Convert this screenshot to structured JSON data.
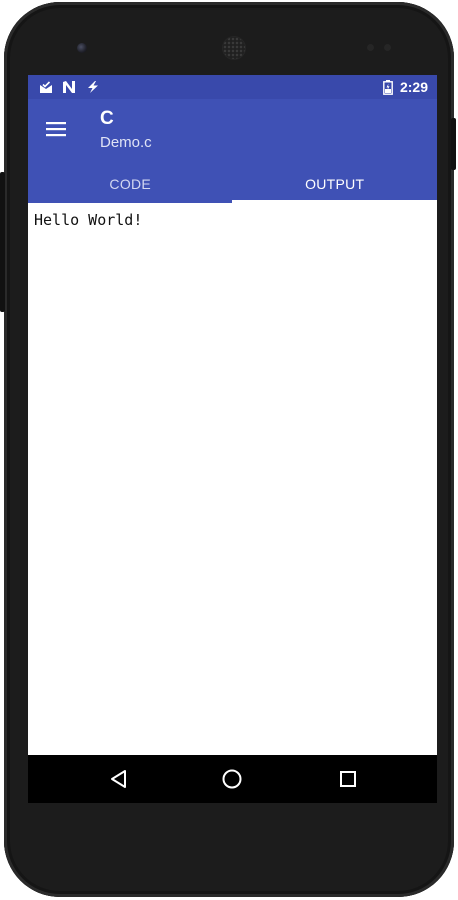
{
  "status_bar": {
    "time": "2:29",
    "icons": [
      "mail-check-icon",
      "n-notification-icon",
      "flash-icon",
      "battery-charging-icon"
    ]
  },
  "app_bar": {
    "title": "C",
    "subtitle": "Demo.c",
    "menu_icon": "menu-icon"
  },
  "tabs": [
    {
      "label": "CODE",
      "selected": false
    },
    {
      "label": "OUTPUT",
      "selected": true
    }
  ],
  "output": {
    "text": "Hello World!"
  },
  "nav_bar": {
    "icons": [
      "back-icon",
      "home-icon",
      "recents-icon"
    ]
  },
  "colors": {
    "status_bar": "#3949ab",
    "app_bar": "#3f51b5",
    "device": "#1c1c1c"
  }
}
